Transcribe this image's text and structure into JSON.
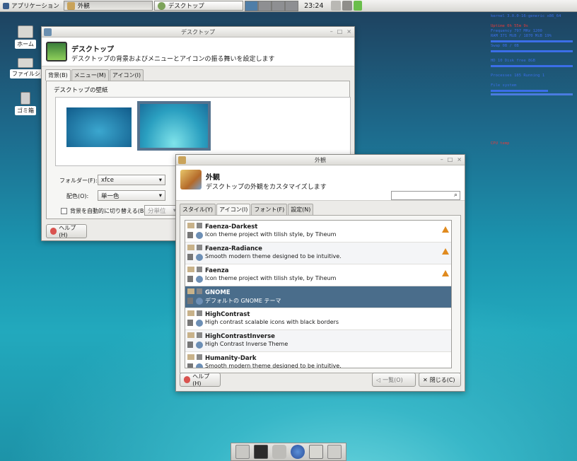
{
  "panel": {
    "apps_label": "アプリケーション",
    "tasks": [
      {
        "label": "外観"
      },
      {
        "label": "デスクトップ"
      }
    ],
    "clock": "23:24"
  },
  "desktop_icons": [
    {
      "label": "ホーム"
    },
    {
      "label": "ファイルシ..."
    },
    {
      "label": "ゴミ箱"
    }
  ],
  "conky": {
    "lines": [
      "kernel 3.0.0-16-generic x86_64",
      "Uptime 0h 55m 9s",
      "Frequency 797 MHz 1200",
      "RAM 371 MiB / 1870 MiB 19%",
      "Swap 0B / 0B",
      "HD 10 Disk free 8GB",
      "Processes 185 Running 1",
      "File system",
      "CPU temp"
    ]
  },
  "desktop_window": {
    "title": "デスクトップ",
    "heading": "デスクトップ",
    "subheading": "デスクトップの背景およびメニューとアイコンの振る舞いを設定します",
    "tabs": [
      "背景(B)",
      "メニュー(M)",
      "アイコン(I)"
    ],
    "wallpaper_label": "デスクトップの壁紙",
    "folder_label": "フォルダー(F):",
    "folder_value": "xfce",
    "color_label": "配色(O):",
    "color_value": "単一色",
    "auto_change_label": "背景を自動的に切り替える(B)",
    "auto_change_value": "分単位",
    "help_label": "ヘルプ(H)"
  },
  "appearance_window": {
    "title": "外観",
    "heading": "外観",
    "subheading": "デスクトップの外観をカスタマイズします",
    "search_placeholder": "",
    "tabs": [
      "スタイル(Y)",
      "アイコン(I)",
      "フォント(F)",
      "設定(N)"
    ],
    "themes": [
      {
        "name": "Faenza-Darkest",
        "desc": "Icon theme project with tilish style, by Tiheum",
        "warn": true
      },
      {
        "name": "Faenza-Radiance",
        "desc": "Smooth modern theme designed to be intuitive.",
        "warn": true
      },
      {
        "name": "Faenza",
        "desc": "Icon theme project with tilish style, by Tiheum",
        "warn": true
      },
      {
        "name": "GNOME",
        "desc": "デフォルトの GNOME テーマ",
        "warn": false,
        "selected": true
      },
      {
        "name": "HighContrast",
        "desc": "High contrast scalable icons with black borders",
        "warn": false
      },
      {
        "name": "HighContrastInverse",
        "desc": "High Contrast Inverse Theme",
        "warn": false
      },
      {
        "name": "Humanity-Dark",
        "desc": "Smooth modern theme designed to be intuitive.",
        "warn": false
      }
    ],
    "help_label": "ヘルプ(H)",
    "overview_label": "一覧(O)",
    "close_label": "閉じる(C)"
  },
  "colors": {
    "selection": "#4a6d8b",
    "warn": "#e08a1e",
    "conky_blue": "#3b6ee8",
    "conky_red": "#e53b3b"
  }
}
